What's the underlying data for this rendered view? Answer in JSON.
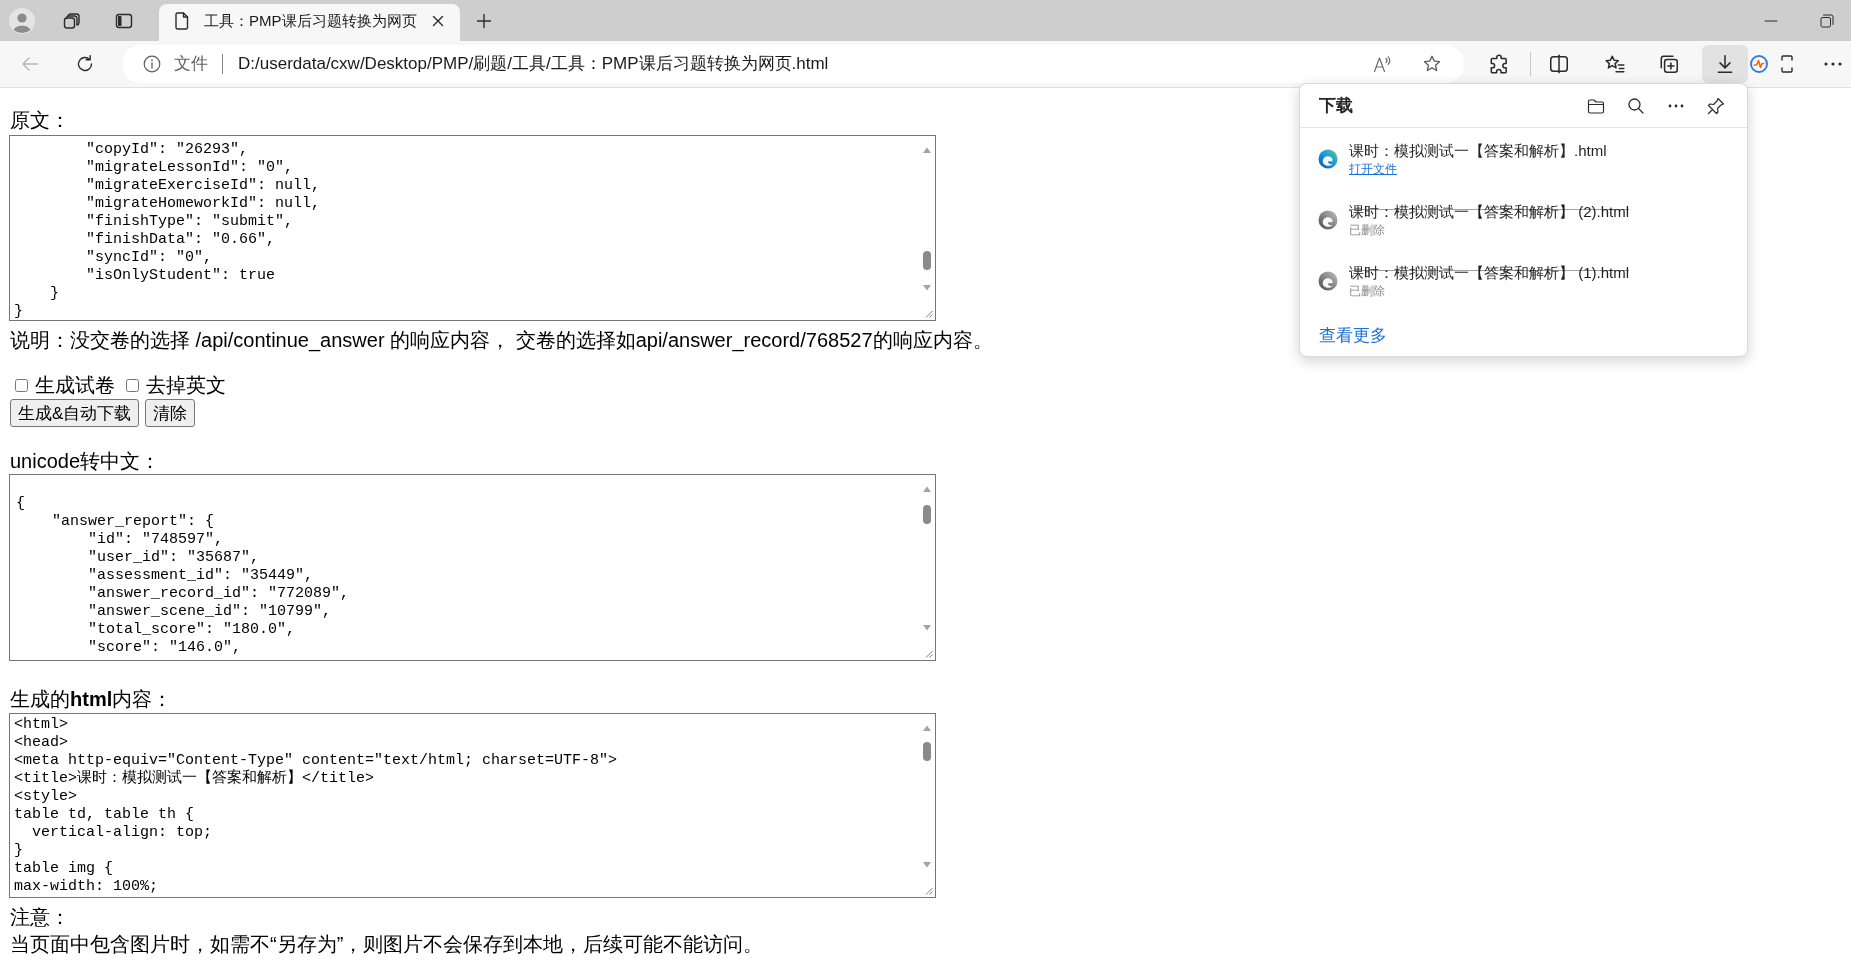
{
  "window": {
    "tabs": [
      {
        "title": "工具：PMP课后习题转换为网页",
        "selected": true
      }
    ]
  },
  "address_bar": {
    "site_label": "文件",
    "url": "D:/userdata/cxw/Desktop/PMP/刷题/工具/工具：PMP课后习题转换为网页.html"
  },
  "toolbar": {
    "back_disabled": true,
    "downloads_pressed": true
  },
  "downloads_panel": {
    "title": "下载",
    "items": [
      {
        "file": "课时：模拟测试一【答案和解析】.html",
        "status": "打开文件",
        "deleted": false
      },
      {
        "file": "课时：模拟测试一【答案和解析】 (2).html",
        "status": "已删除",
        "deleted": true
      },
      {
        "file": "课时：模拟测试一【答案和解析】 (1).html",
        "status": "已删除",
        "deleted": true
      }
    ],
    "see_more": "查看更多"
  },
  "page": {
    "source_label": "原文：",
    "source_text": "        \"copyId\": \"26293\",\n        \"migrateLessonId\": \"0\",\n        \"migrateExerciseId\": null,\n        \"migrateHomeworkId\": null,\n        \"finishType\": \"submit\",\n        \"finishData\": \"0.66\",\n        \"syncId\": \"0\",\n        \"isOnlyStudent\": true\n    }\n}",
    "description": "说明：没交卷的选择 /api/continue_answer 的响应内容， 交卷的选择如api/answer_record/768527的响应内容。",
    "options": [
      {
        "label": "生成试卷",
        "checked": false
      },
      {
        "label": "去掉英文",
        "checked": false
      }
    ],
    "buttons": [
      "生成&自动下载",
      "清除"
    ],
    "unicode_label": "unicode转中文：",
    "unicode_text": "{\n    \"answer_report\": {\n        \"id\": \"748597\",\n        \"user_id\": \"35687\",\n        \"assessment_id\": \"35449\",\n        \"answer_record_id\": \"772089\",\n        \"answer_scene_id\": \"10799\",\n        \"total_score\": \"180.0\",\n        \"score\": \"146.0\",",
    "html_label": "生成的**html**内容：",
    "html_text": "<html>\n<head>\n<meta http-equiv=\"Content-Type\" content=\"text/html; charset=UTF-8\">\n<title>课时：模拟测试一【答案和解析】</title>\n<style>\ntable td, table th {\n  vertical-align: top;\n}\ntable img {\nmax-width: 100%;",
    "note_label": "注意：",
    "note_text": "当页面中包含图片时，如需不“另存为”，则图片不会保存到本地，后续可能不能访问。"
  }
}
